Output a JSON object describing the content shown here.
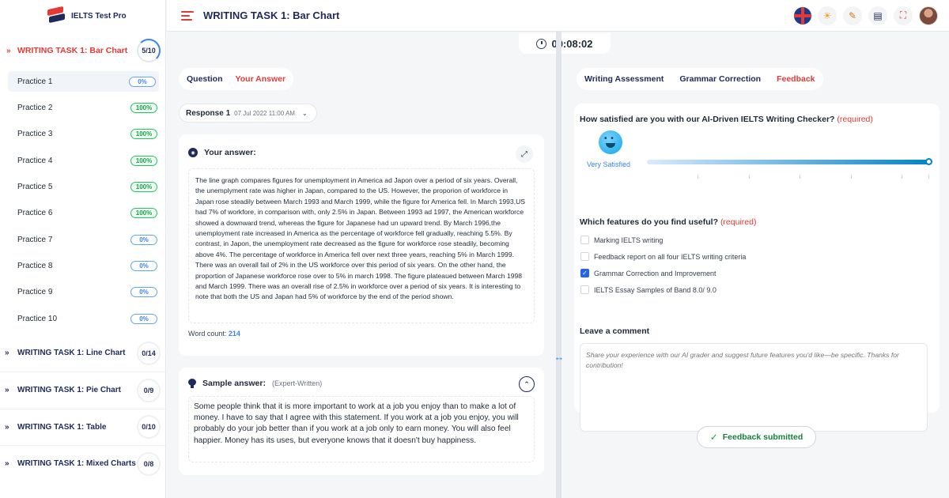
{
  "brand": {
    "name": "IELTS Test Pro"
  },
  "header": {
    "title": "WRITING TASK 1: Bar Chart"
  },
  "timer": {
    "value": "00:08:02"
  },
  "sidebar": {
    "open_group": {
      "title": "WRITING TASK 1: Bar Chart",
      "progress": "5/10"
    },
    "practices": [
      {
        "label": "Practice 1",
        "score": "0%",
        "status": "blue"
      },
      {
        "label": "Practice 2",
        "score": "100%",
        "status": "green"
      },
      {
        "label": "Practice 3",
        "score": "100%",
        "status": "green"
      },
      {
        "label": "Practice 4",
        "score": "100%",
        "status": "green"
      },
      {
        "label": "Practice 5",
        "score": "100%",
        "status": "green"
      },
      {
        "label": "Practice 6",
        "score": "100%",
        "status": "green"
      },
      {
        "label": "Practice 7",
        "score": "0%",
        "status": "blue"
      },
      {
        "label": "Practice 8",
        "score": "0%",
        "status": "blue"
      },
      {
        "label": "Practice 9",
        "score": "0%",
        "status": "blue"
      },
      {
        "label": "Practice 10",
        "score": "0%",
        "status": "blue"
      }
    ],
    "groups": [
      {
        "title": "WRITING TASK 1: Line Chart",
        "progress": "0/14"
      },
      {
        "title": "WRITING TASK 1: Pie Chart",
        "progress": "0/9"
      },
      {
        "title": "WRITING TASK 1: Table",
        "progress": "0/10"
      },
      {
        "title": "WRITING TASK 1: Mixed Charts",
        "progress": "0/8"
      }
    ]
  },
  "left_tabs": {
    "question": "Question",
    "your_answer": "Your Answer"
  },
  "response": {
    "label": "Response 1",
    "date": "07 Jul 2022 11:00 AM"
  },
  "answer": {
    "heading": "Your answer:",
    "text": "The line graph compares figures for unemployment in America ad Japon over a period of six years. Overall, the unemplyment rate was higher in Japan, compared to the US. However, the proporion of workforce in Japan rose steadily between March 1993 and March 1999, while the figure for America fell. In March 1993,US had 7% of workfore, in comparison with, only 2.5% in Japan. Between 1993 ad 1997, the American workforce showed a downward trend, whereas the figure for Japanese had un upward trend. By March 1996,the unemployment rate increased in America as the percentage of workforce fell gradually, reaching 5.5%. By contrast, in Japon, the unemployment rate decreased as the figure for workforce rose steadily, becoming above 4%. The percentage of workforce in America fell over next three years, reaching 5% in March 1999. There was an overall fail of 2% in the US workforce over this period of six years. On the other hand, the proportion of Japanese workforce rose over to 5% in march 1998. The figure plateaued between March 1998 and March 1999. There was an overall rise of 2.5% in workforce over a period of six years. It is interesting to note that both the US and Japan had 5% of workforce by the end of the period shown.",
    "word_count_label": "Word count:",
    "word_count": "214"
  },
  "sample": {
    "heading": "Sample answer:",
    "sub": "(Expert-Written)",
    "text": "Some people think that it is more important to work at a job you enjoy than to make a lot of money. I have to say that I agree with this statement. If you work at a job you enjoy, you will probably do your job better than if you work at a job only to earn money. You will also feel happier. Money has its uses, but everyone knows that it doesn't buy happiness."
  },
  "right_tabs": {
    "assessment": "Writing Assessment",
    "grammar": "Grammar Correction",
    "feedback": "Feedback"
  },
  "feedback": {
    "q1": "How satisfied are you with our AI-Driven IELTS Writing Checker?",
    "required": "(required)",
    "satisfaction_label": "Very Satisfied",
    "satisfaction_level": 1.0,
    "q2": "Which features do you find useful?",
    "options": [
      {
        "label": "Marking IELTS writing",
        "checked": false
      },
      {
        "label": "Feedback report on all four IELTS writing criteria",
        "checked": false
      },
      {
        "label": "Grammar Correction and Improvement",
        "checked": true
      },
      {
        "label": "IELTS Essay Samples of Band 8.0/ 9.0",
        "checked": false
      }
    ],
    "q3": "Leave a comment",
    "comment_placeholder": "Share your experience with our AI grader and suggest future features you'd like—be specific. Thanks for contribution!",
    "submitted_label": "Feedback submitted"
  },
  "colors": {
    "accent_red": "#e53935",
    "navy": "#1e2a5a",
    "blue": "#3b82f6",
    "green": "#16a34a"
  }
}
